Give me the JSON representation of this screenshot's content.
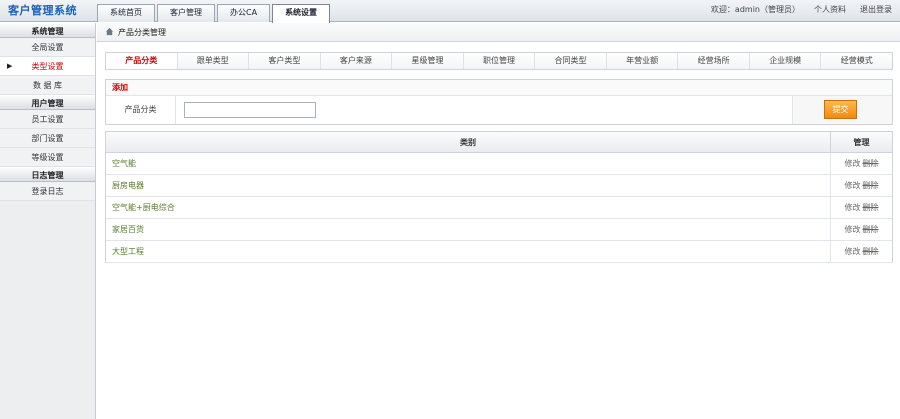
{
  "app": {
    "title": "客户管理系统"
  },
  "main_tabs": [
    {
      "label": "系统首页",
      "active": false
    },
    {
      "label": "客户管理",
      "active": false
    },
    {
      "label": "办公CA",
      "active": false
    },
    {
      "label": "系统设置",
      "active": true
    }
  ],
  "user": {
    "welcome": "欢迎：admin（管理员）",
    "profile": "个人资料",
    "logout": "退出登录"
  },
  "sidebar": {
    "groups": [
      {
        "title": "系统管理",
        "items": [
          "全局设置",
          "类型设置",
          "数 据 库"
        ]
      },
      {
        "title": "用户管理",
        "items": [
          "员工设置",
          "部门设置",
          "等级设置"
        ]
      },
      {
        "title": "日志管理",
        "items": [
          "登录日志"
        ]
      }
    ],
    "active_item": "类型设置"
  },
  "breadcrumb": {
    "title": "产品分类管理"
  },
  "sub_tabs": [
    "产品分类",
    "跟单类型",
    "客户类型",
    "客户来源",
    "星级管理",
    "职位管理",
    "合同类型",
    "年营业额",
    "经营场所",
    "企业规模",
    "经营模式"
  ],
  "add_panel": {
    "title": "添加",
    "label": "产品分类",
    "value": "",
    "submit": "提交"
  },
  "grid": {
    "headers": {
      "name": "类别",
      "action": "管理"
    },
    "rows": [
      {
        "name": "空气能",
        "edit": "修改",
        "delete": "删除"
      },
      {
        "name": "厨房电器",
        "edit": "修改",
        "delete": "删除"
      },
      {
        "name": "空气能+厨电综合",
        "edit": "修改",
        "delete": "删除"
      },
      {
        "name": "家居百货",
        "edit": "修改",
        "delete": "删除"
      },
      {
        "name": "大型工程",
        "edit": "修改",
        "delete": "删除"
      }
    ]
  },
  "colors": {
    "accent": "#c00000",
    "brand": "#1a62b8",
    "submit": "#f08a10"
  }
}
